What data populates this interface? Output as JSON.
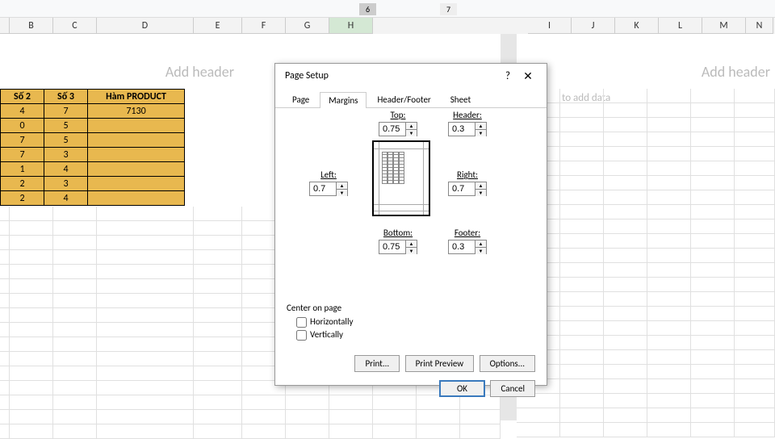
{
  "ruler": {
    "tab1": "6",
    "tab2": "7"
  },
  "columns": [
    "B",
    "C",
    "D",
    "E",
    "F",
    "G",
    "H",
    "I",
    "J",
    "K",
    "L",
    "M",
    "N"
  ],
  "active_col": "H",
  "sheet": {
    "add_header": "Add header",
    "type_hint": "to add data",
    "headers": [
      "Số 2",
      "Số 3",
      "Hàm PRODUCT"
    ],
    "rows": [
      [
        "4",
        "7",
        "7130"
      ],
      [
        "0",
        "5",
        ""
      ],
      [
        "7",
        "5",
        ""
      ],
      [
        "7",
        "3",
        ""
      ],
      [
        "1",
        "4",
        ""
      ],
      [
        "2",
        "3",
        ""
      ],
      [
        "2",
        "4",
        ""
      ]
    ]
  },
  "dialog": {
    "title": "Page Setup",
    "tabs": [
      "Page",
      "Margins",
      "Header/Footer",
      "Sheet"
    ],
    "active_tab": "Margins",
    "margins": {
      "top_label": "Top:",
      "top": "0.75",
      "header_label": "Header:",
      "header": "0.3",
      "left_label": "Left:",
      "left": "0.7",
      "right_label": "Right:",
      "right": "0.7",
      "bottom_label": "Bottom:",
      "bottom": "0.75",
      "footer_label": "Footer:",
      "footer": "0.3"
    },
    "center_title": "Center on page",
    "center_h": "Horizontally",
    "center_v": "Vertically",
    "buttons": {
      "print": "Print...",
      "preview": "Print Preview",
      "options": "Options...",
      "ok": "OK",
      "cancel": "Cancel"
    }
  }
}
